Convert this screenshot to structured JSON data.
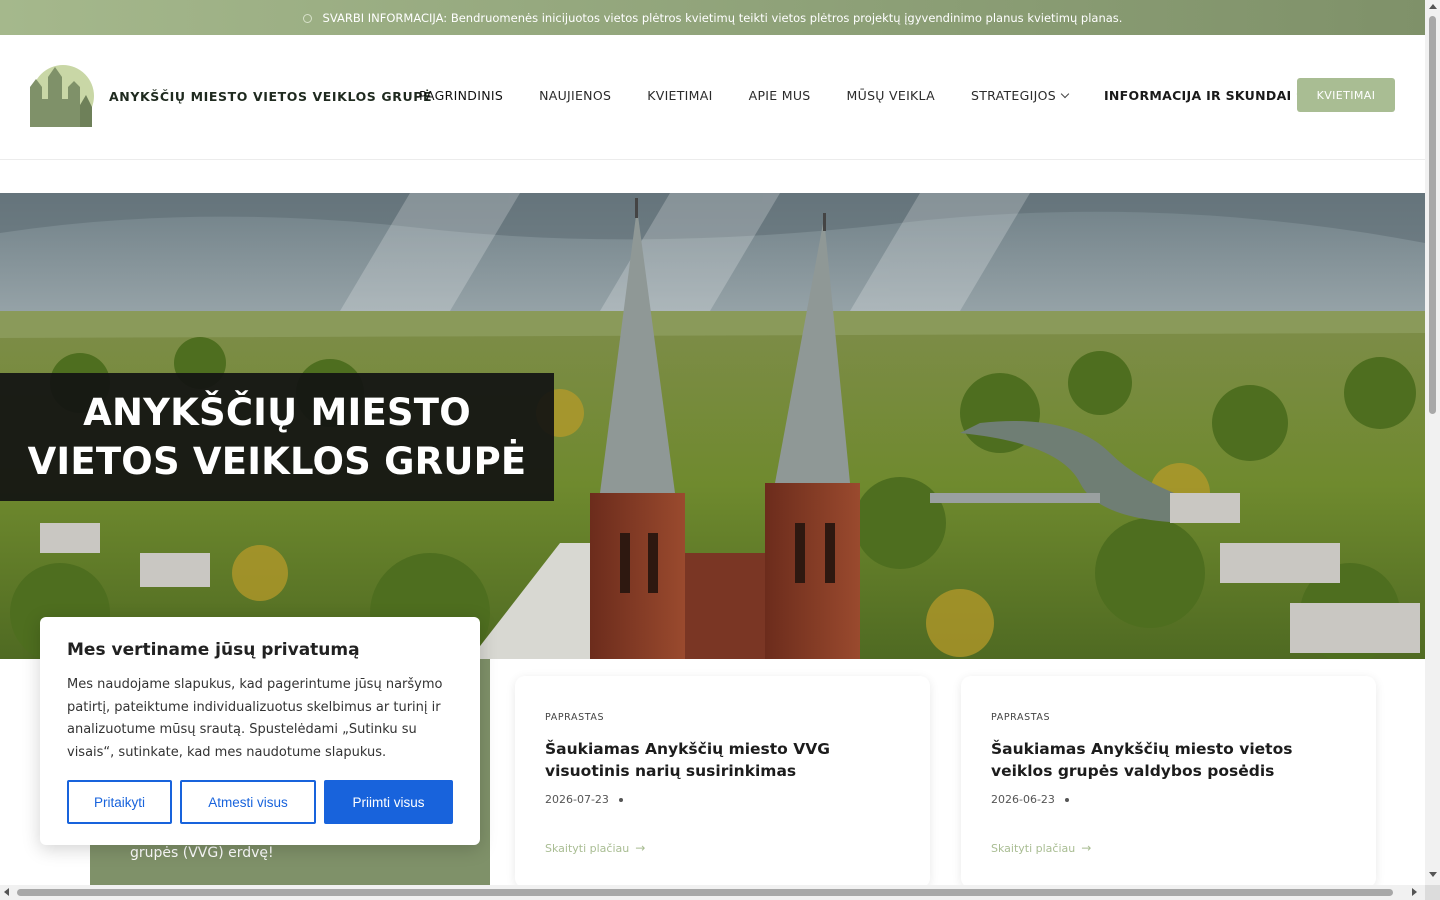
{
  "announcement": {
    "text": "SVARBI INFORMACIJA: Bendruomenės inicijuotos vietos plėtros kvietimų teikti vietos plėtros projektų įgyvendinimo planus kvietimų planas."
  },
  "header": {
    "brand": "ANYKŠČIŲ MIESTO VIETOS VEIKLOS GRUPĖ",
    "nav": [
      {
        "label": "PAGRINDINIS"
      },
      {
        "label": "NAUJIENOS"
      },
      {
        "label": "KVIETIMAI"
      },
      {
        "label": "APIE MUS"
      },
      {
        "label": "MŪSŲ VEIKLA"
      },
      {
        "label": "STRATEGIJOS"
      },
      {
        "label": "INFORMACIJA IR SKUNDAI"
      }
    ],
    "cta_label": "KVIETIMAI"
  },
  "hero": {
    "title_line1": "ANYKŠČIŲ MIESTO",
    "title_line2": "VIETOS VEIKLOS GRUPĖ"
  },
  "intro": {
    "text": "grupės (VVG) erdvę!"
  },
  "cards": [
    {
      "category": "PAPRASTAS",
      "title": "Šaukiamas Anykščių miesto VVG visuotinis narių susirinkimas",
      "date": "2026-07-23",
      "more": "Skaityti plačiau"
    },
    {
      "category": "PAPRASTAS",
      "title": "Šaukiamas Anykščių miesto vietos veiklos grupės valdybos posėdis",
      "date": "2026-06-23",
      "more": "Skaityti plačiau"
    }
  ],
  "cookie": {
    "heading": "Mes vertiname jūsų privatumą",
    "body": "Mes naudojame slapukus, kad pagerintume jūsų naršymo patirtį, pateiktume individualizuotus skelbimus ar turinį ir analizuotume mūsų srautą. Spustelėdami „Sutinku su visais“, sutinkate, kad mes naudotume slapukus.",
    "customize": "Pritaikyti",
    "reject": "Atmesti visus",
    "accept": "Priimti visus"
  },
  "colors": {
    "brand_green": "#7f9169",
    "light_green": "#a9bd93",
    "cookie_blue": "#1863dc"
  }
}
